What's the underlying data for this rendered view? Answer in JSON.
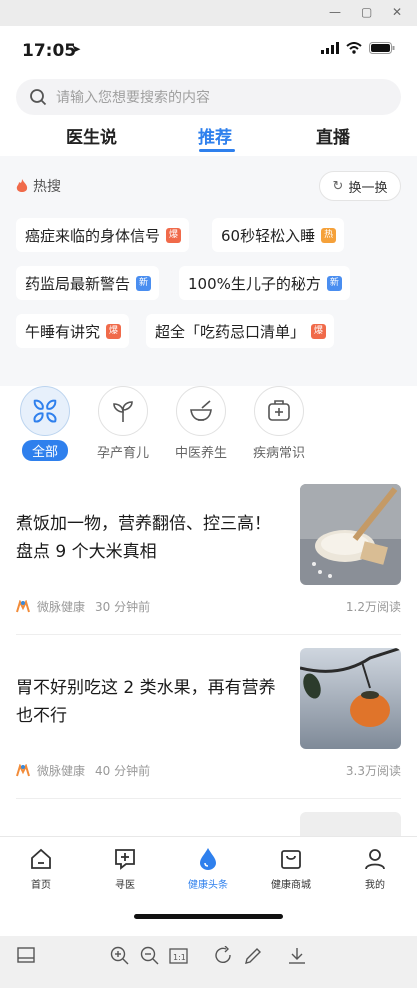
{
  "status": {
    "time": "17:05"
  },
  "search": {
    "placeholder": "请输入您想要搜索的内容"
  },
  "tabs": [
    {
      "label": "医生说"
    },
    {
      "label": "推荐"
    },
    {
      "label": "直播"
    }
  ],
  "hot": {
    "title": "热搜",
    "refresh": "换一换",
    "chips": [
      {
        "text": "癌症来临的身体信号",
        "badge": "爆",
        "badge_color": "#f06a4a"
      },
      {
        "text": "60秒轻松入睡",
        "badge": "热",
        "badge_color": "#f5a13a"
      },
      {
        "text": "药监局最新警告",
        "badge": "新",
        "badge_color": "#4a8ef0"
      },
      {
        "text": "100%生儿子的秘方",
        "badge": "新",
        "badge_color": "#4a8ef0"
      },
      {
        "text": "午睡有讲究",
        "badge": "爆",
        "badge_color": "#f06a4a"
      },
      {
        "text": "超全「吃药忌口清单」",
        "badge": "爆",
        "badge_color": "#f06a4a"
      }
    ]
  },
  "categories": [
    {
      "label": "全部",
      "icon": "grid-icon"
    },
    {
      "label": "孕产育儿",
      "icon": "sprout-icon"
    },
    {
      "label": "中医养生",
      "icon": "mortar-icon"
    },
    {
      "label": "疾病常识",
      "icon": "medkit-icon"
    }
  ],
  "articles": [
    {
      "title": "煮饭加一物，营养翻倍、控三高！盘点 9 个大米真相",
      "source": "微脉健康",
      "time": "30 分钟前",
      "reads": "1.2万阅读"
    },
    {
      "title": "胃不好别吃这 2 类水果，再有营养也不行",
      "source": "微脉健康",
      "time": "40 分钟前",
      "reads": "3.3万阅读"
    }
  ],
  "nav": [
    {
      "label": "首页"
    },
    {
      "label": "寻医"
    },
    {
      "label": "健康头条"
    },
    {
      "label": "健康商城"
    },
    {
      "label": "我的"
    }
  ],
  "colors": {
    "accent": "#2f80ed",
    "hot_red": "#f06a4a",
    "hot_orange": "#f5a13a"
  }
}
